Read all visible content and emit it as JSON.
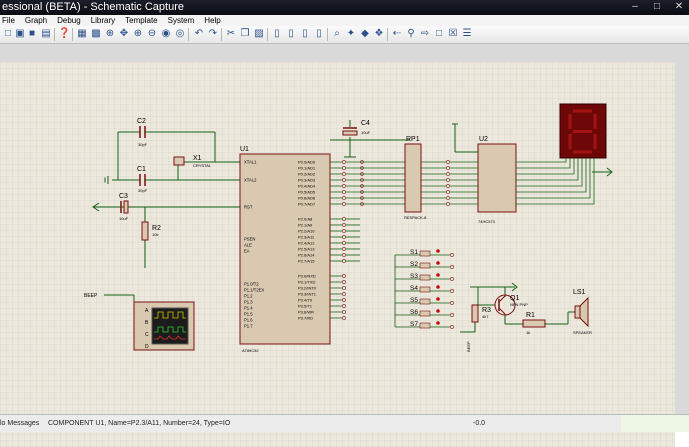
{
  "window": {
    "title": "essional (BETA) - Schematic Capture"
  },
  "menu": [
    "File",
    "Graph",
    "Debug",
    "Library",
    "Template",
    "System",
    "Help"
  ],
  "status": {
    "left": "lo Messages",
    "component": "COMPONENT U1, Name=P2.3/A11, Number=24, Type=IO",
    "coord": "-0.0"
  },
  "labels": {
    "c2": "C2",
    "c2_val": "30pF",
    "c1": "C1",
    "c1_val": "30pF",
    "x1": "X1",
    "x1_val": "CRYSTAL",
    "c3": "C3",
    "c3_val": "10uF",
    "r2": "R2",
    "r2_val": "10k",
    "c4": "C4",
    "c4_val": "10uF",
    "u1": "U1",
    "u1_model": "AT89C52",
    "rp1": "RP1",
    "rp1_model": "RESPACK-8",
    "u2": "U2",
    "u2_model": "74HC573",
    "q1": "Q1",
    "q1_model": "NPN PNP",
    "r3": "R3",
    "r3_val": "4k7",
    "r1": "R1",
    "r1_val": "1k",
    "ls1": "LS1",
    "ls1_model": "SPEAKER",
    "beep": "BEEP",
    "s_labels": [
      "S1",
      "S2",
      "S3",
      "S4",
      "S5",
      "S6",
      "S7"
    ]
  },
  "u1_left_pins": [
    "XTAL1",
    "XTAL2",
    "RST",
    "PSEN",
    "ALE",
    "EA",
    "P1.0/T2",
    "P1.1/T2EX",
    "P1.2",
    "P1.3",
    "P1.4",
    "P1.5",
    "P1.6",
    "P1.7"
  ],
  "u1_right_pins": [
    "P0.0/AD0",
    "P0.1/AD1",
    "P0.2/AD2",
    "P0.3/AD3",
    "P0.4/AD4",
    "P0.5/AD5",
    "P0.6/AD6",
    "P0.7/AD7",
    "P2.0/A8",
    "P2.1/A9",
    "P2.2/A10",
    "P2.3/A11",
    "P2.4/A12",
    "P2.5/A13",
    "P2.6/A14",
    "P2.7/A15",
    "P3.0/RXD",
    "P3.1/TXD",
    "P3.2/INT0",
    "P3.3/INT1",
    "P3.4/T0",
    "P3.5/T1",
    "P3.6/WR",
    "P3.7/RD"
  ],
  "colors": {
    "grid": "#c9c9c9",
    "sheet": "#ece8dc",
    "wire": "#146214",
    "part": "#7a1010",
    "partfill": "#d9c9b0",
    "display": "#8a0c0c"
  }
}
